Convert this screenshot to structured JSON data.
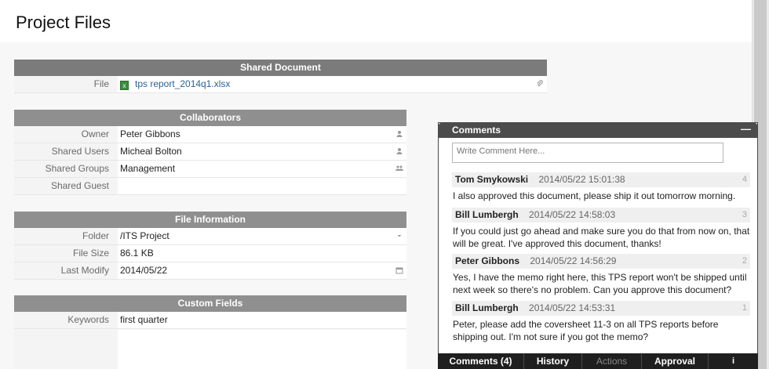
{
  "page": {
    "title": "Project Files"
  },
  "shared_document": {
    "header": "Shared Document",
    "file_label": "File",
    "file_name": "tps report_2014q1.xlsx",
    "file_icon_glyph": "x"
  },
  "collaborators": {
    "header": "Collaborators",
    "rows": [
      {
        "label": "Owner",
        "value": "Peter Gibbons",
        "icon": "user-icon"
      },
      {
        "label": "Shared Users",
        "value": "Micheal Bolton",
        "icon": "user-icon"
      },
      {
        "label": "Shared Groups",
        "value": "Management",
        "icon": "group-icon"
      },
      {
        "label": "Shared Guest",
        "value": "",
        "icon": ""
      }
    ]
  },
  "file_information": {
    "header": "File Information",
    "rows": [
      {
        "label": "Folder",
        "value": "/ITS Project",
        "icon": "caret-down-icon"
      },
      {
        "label": "File Size",
        "value": "86.1 KB",
        "icon": ""
      },
      {
        "label": "Last Modify",
        "value": "2014/05/22",
        "icon": "calendar-icon"
      }
    ]
  },
  "custom_fields": {
    "header": "Custom Fields",
    "rows": [
      {
        "label": "Keywords",
        "value": "first quarter"
      }
    ]
  },
  "comments_panel": {
    "title": "Comments",
    "minimize_glyph": "—",
    "input_placeholder": "Write Comment Here...",
    "comments": [
      {
        "author": "Tom Smykowski",
        "timestamp": "2014/05/22 15:01:38",
        "number": "4",
        "text": "I also approved this document, please ship it out tomorrow morning."
      },
      {
        "author": "Bill Lumbergh",
        "timestamp": "2014/05/22 14:58:03",
        "number": "3",
        "text": "If you could just go ahead and make sure you do that from now on, that will be great. I've approved this document, thanks!"
      },
      {
        "author": "Peter Gibbons",
        "timestamp": "2014/05/22 14:56:29",
        "number": "2",
        "text": "Yes, I have the memo right here, this TPS report won't be shipped until next week so there's no problem. Can you approve this document?"
      },
      {
        "author": "Bill Lumbergh",
        "timestamp": "2014/05/22 14:53:31",
        "number": "1",
        "text": "Peter, please add the coversheet 11-3 on all TPS reports before shipping out. I'm not sure if you got the memo?"
      }
    ],
    "tabs": [
      {
        "label": "Comments (4)",
        "state": "active"
      },
      {
        "label": "History",
        "state": "normal"
      },
      {
        "label": "Actions",
        "state": "disabled"
      },
      {
        "label": "Approval",
        "state": "normal"
      },
      {
        "label": "i",
        "state": "info"
      }
    ]
  },
  "colors": {
    "section_header": "#8f8f8f",
    "comments_header": "#4c4c4c",
    "tab_bar": "#1f1f1f",
    "link": "#2a6496",
    "xlsx_icon": "#3c8d3c"
  }
}
